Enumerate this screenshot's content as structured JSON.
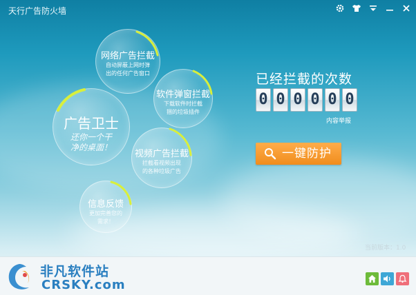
{
  "window": {
    "title": "天行广告防火墙"
  },
  "titlebar_icons": [
    "gear-icon",
    "shirt-icon",
    "menu-down-icon",
    "minimize-icon",
    "close-icon"
  ],
  "bubbles": {
    "network": {
      "title": "网络广告拦截",
      "desc": [
        "自动屏蔽上网时弹",
        "出的任何广告窗口"
      ]
    },
    "popup": {
      "title": "软件弹窗拦截",
      "desc": [
        "下载软件时拦截",
        "捆的垃圾插件"
      ]
    },
    "guard": {
      "title": "广告卫士",
      "desc": [
        "还你一个干",
        "净的桌面！"
      ]
    },
    "video": {
      "title": "视频广告拦截",
      "desc": [
        "拦截看视频出现",
        "的各种垃圾广告"
      ]
    },
    "feedback": {
      "title": "信息反馈",
      "desc": [
        "更加完善您的",
        "需求！"
      ]
    }
  },
  "stats": {
    "headline": "已经拦截的次数",
    "digits": [
      "0",
      "0",
      "0",
      "0",
      "0",
      "0"
    ],
    "report_link": "内容举报"
  },
  "actions": {
    "protect_label": "一键防护"
  },
  "version": {
    "text": "当前版本：1.0"
  },
  "footer": {
    "logo_cn": "非凡软件站",
    "logo_en": "CRSKY.com",
    "buttons": [
      "home-icon",
      "volume-icon",
      "bell-icon"
    ]
  },
  "colors": {
    "accent": "#f5a233",
    "arc": "#d8ef3c",
    "home": "#6dbb3a",
    "volume": "#3ea7d6",
    "bell": "#ef6f7a"
  }
}
